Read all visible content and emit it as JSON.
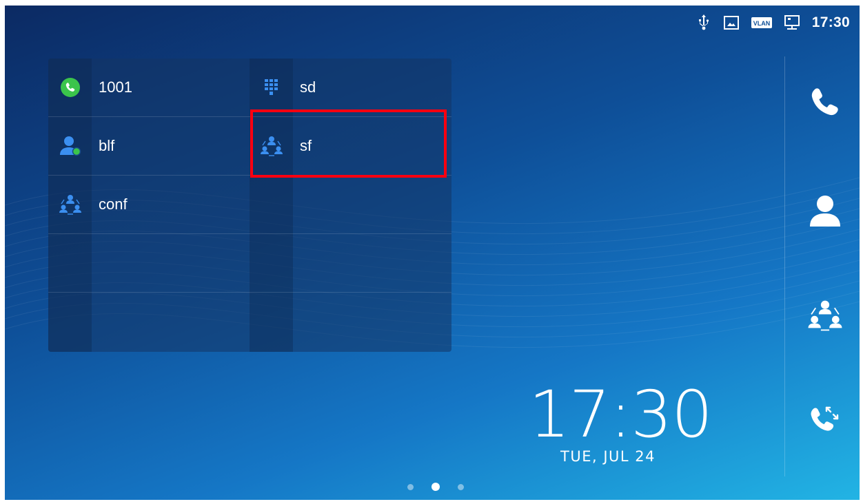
{
  "status_bar": {
    "icons": [
      "usb-icon",
      "screenshot-icon",
      "vlan-icon",
      "network-icon"
    ],
    "vlan_text": "VLAN",
    "time": "17:30"
  },
  "panel": {
    "keys": [
      {
        "label": "1001",
        "icon": "phone-green-icon"
      },
      {
        "label": "sd",
        "icon": "dialpad-icon"
      },
      {
        "label": "blf",
        "icon": "contact-online-icon"
      },
      {
        "label": "sf",
        "icon": "group-icon"
      },
      {
        "label": "conf",
        "icon": "group-icon"
      }
    ]
  },
  "sidebar": {
    "items": [
      "phone-icon",
      "contacts-icon",
      "conference-icon",
      "call-history-icon"
    ]
  },
  "clock": {
    "time": "17:30",
    "date": "TUE, JUL 24"
  },
  "pager": {
    "pages": 3,
    "active_index": 1
  },
  "colors": {
    "highlight": "#ff0010",
    "accent_blue": "#3b8ff0",
    "online_green": "#3bc44b"
  }
}
